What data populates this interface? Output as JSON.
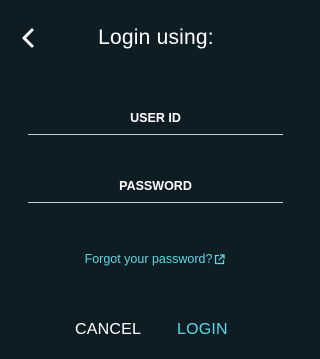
{
  "header": {
    "title": "Login using:",
    "back_icon": "chevron-left-icon"
  },
  "form": {
    "user_id_label": "USER ID",
    "user_id_value": "",
    "password_label": "PASSWORD",
    "password_value": ""
  },
  "links": {
    "forgot_password": "Forgot your password?",
    "forgot_password_icon": "external-link-icon"
  },
  "actions": {
    "cancel_label": "CANCEL",
    "login_label": "LOGIN"
  },
  "colors": {
    "background": "#0e1c24",
    "accent": "#5ed6e0",
    "text": "#ffffff",
    "underline": "#c7cfd4"
  }
}
